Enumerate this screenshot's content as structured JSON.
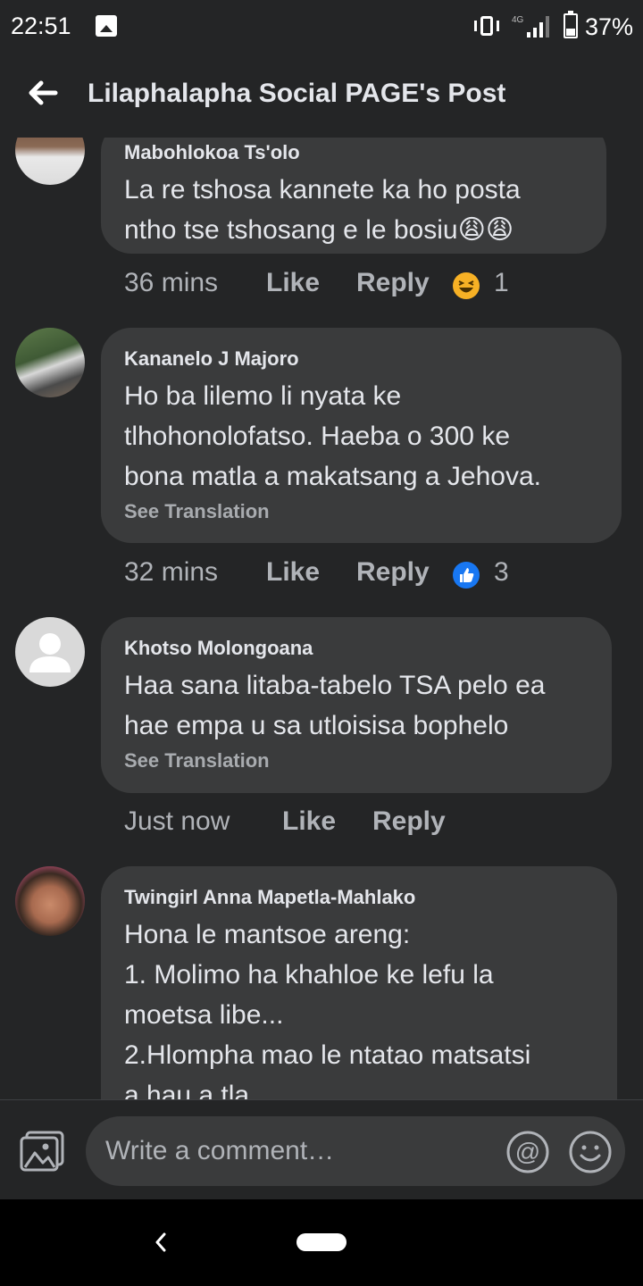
{
  "status_bar": {
    "time": "22:51",
    "network": "4G",
    "battery": "37%",
    "battery_level": 0.37
  },
  "header": {
    "title": "Lilaphalapha Social PAGE's Post"
  },
  "comments": [
    {
      "author": "Mabohlokoa Ts'olo",
      "lines": [
        "La re tshosa kannete ka ho posta",
        "ntho tse tshosang e le bosiu😩😩"
      ],
      "time": "36 mins",
      "like": "Like",
      "reply": "Reply",
      "reaction": "laugh-reaction-icon",
      "reaction_count": "1"
    },
    {
      "author": "Kananelo J Majoro",
      "lines": [
        "Ho ba lilemo li  nyata ke",
        "tlhohonolofatso. Haeba o 300 ke",
        "bona matla a makatsang a Jehova."
      ],
      "see_translation": "See Translation",
      "time": "32 mins",
      "like": "Like",
      "reply": "Reply",
      "reaction": "like-reaction-icon",
      "reaction_count": "3"
    },
    {
      "author": "Khotso Molongoana",
      "lines": [
        "Haa sana litaba-tabelo TSA pelo ea",
        "hae empa u sa utloisisa bophelo"
      ],
      "see_translation": "See Translation",
      "time": "Just now",
      "like": "Like",
      "reply": "Reply"
    },
    {
      "author": "Twingirl Anna Mapetla-Mahlako",
      "lines": [
        "Hona le mantsoe areng:",
        "1. Molimo ha khahloe ke lefu la",
        "moetsa libe...",
        "2.Hlompha mao le ntatao matsatsi",
        "a hau a tla..."
      ]
    }
  ],
  "composer": {
    "placeholder": "Write a comment…"
  },
  "colors": {
    "background": "#242526",
    "bubble": "#3a3b3c",
    "text": "#e4e6eb",
    "muted": "#b0b3b8",
    "like_blue": "#1877f2"
  }
}
